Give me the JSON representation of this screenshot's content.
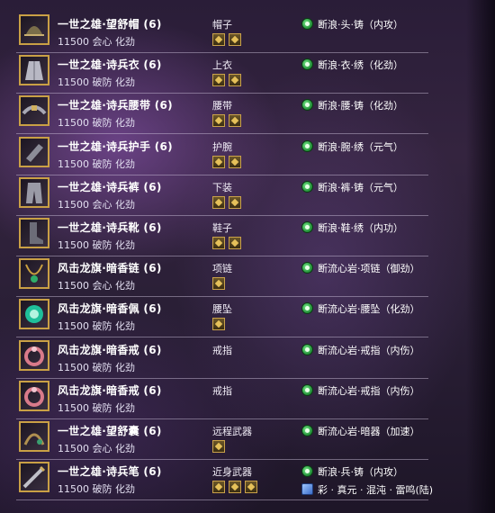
{
  "items": [
    {
      "name": "一世之雄·望舒帽 (6)",
      "stats": "11500 会心 化劲",
      "slot": "帽子",
      "gems": 2,
      "enhance": "断浪·头·铸（内攻）",
      "icon": "hat-icon"
    },
    {
      "name": "一世之雄·诗兵衣 (6)",
      "stats": "11500 破防 化劲",
      "slot": "上衣",
      "gems": 2,
      "enhance": "断浪·衣·绣（化劲）",
      "icon": "robe-icon"
    },
    {
      "name": "一世之雄·诗兵腰带 (6)",
      "stats": "11500 破防 化劲",
      "slot": "腰带",
      "gems": 2,
      "enhance": "断浪·腰·铸（化劲）",
      "icon": "belt-icon"
    },
    {
      "name": "一世之雄·诗兵护手 (6)",
      "stats": "11500 破防 化劲",
      "slot": "护腕",
      "gems": 2,
      "enhance": "断浪·腕·绣（元气）",
      "icon": "bracer-icon"
    },
    {
      "name": "一世之雄·诗兵裤 (6)",
      "stats": "11500 会心 化劲",
      "slot": "下装",
      "gems": 2,
      "enhance": "断浪·裤·铸（元气）",
      "icon": "pants-icon"
    },
    {
      "name": "一世之雄·诗兵靴 (6)",
      "stats": "11500 破防 化劲",
      "slot": "鞋子",
      "gems": 2,
      "enhance": "断浪·鞋·绣（内功）",
      "icon": "boots-icon"
    },
    {
      "name": "风击龙旗·暗香链 (6)",
      "stats": "11500 会心 化劲",
      "slot": "项链",
      "gems": 1,
      "enhance": "断流心岩·项链（御劲）",
      "icon": "necklace-icon"
    },
    {
      "name": "风击龙旗·暗香佩 (6)",
      "stats": "11500 破防 化劲",
      "slot": "腰坠",
      "gems": 1,
      "enhance": "断流心岩·腰坠（化劲）",
      "icon": "pendant-icon"
    },
    {
      "name": "风击龙旗·暗香戒 (6)",
      "stats": "11500 破防 化劲",
      "slot": "戒指",
      "gems": 0,
      "enhance": "断流心岩·戒指（内伤）",
      "icon": "ring-icon"
    },
    {
      "name": "风击龙旗·暗香戒 (6)",
      "stats": "11500 破防 化劲",
      "slot": "戒指",
      "gems": 0,
      "enhance": "断流心岩·戒指（内伤）",
      "icon": "ring-icon"
    },
    {
      "name": "一世之雄·望舒囊 (6)",
      "stats": "11500 会心 化劲",
      "slot": "远程武器",
      "gems": 1,
      "enhance": "断流心岩·暗器（加速）",
      "icon": "pouch-icon"
    },
    {
      "name": "一世之雄·诗兵笔 (6)",
      "stats": "11500 破防 化劲",
      "slot": "近身武器",
      "gems": 3,
      "enhance": "断浪·兵·铸（内攻）",
      "enhance2": "彩 · 真元 · 混沌 · 雷鸣(陆)",
      "icon": "brush-weapon-icon"
    }
  ]
}
